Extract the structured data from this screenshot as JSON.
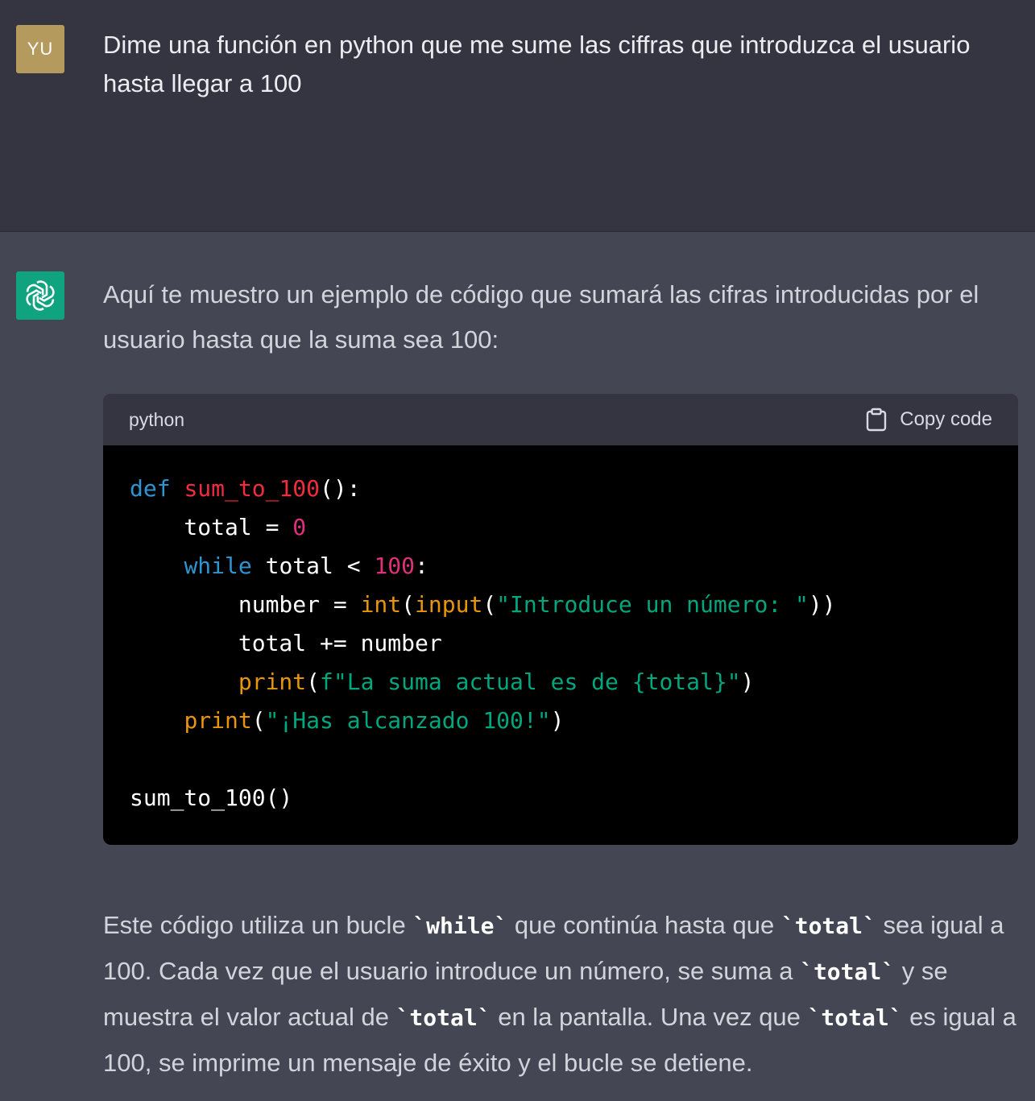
{
  "user": {
    "avatar_initials": "YU",
    "message": "Dime una función en python que me sume las ciffras que introduzca el usuario hasta llegar a 100"
  },
  "assistant": {
    "avatar_icon": "openai-logo-icon",
    "intro": "Aquí te muestro un ejemplo de código que sumará las cifras introducidas por el usuario hasta que la suma sea 100:",
    "code_block": {
      "language": "python",
      "copy_label": "Copy code",
      "copy_icon": "clipboard-icon",
      "lines": {
        "l1_def": "def",
        "l1_name": "sum_to_100",
        "l1_rest": "():",
        "l2_text": "    total = ",
        "l2_num": "0",
        "l3_kw": "while",
        "l3_text": " total < ",
        "l3_num": "100",
        "l3_rest": ":",
        "l4_text": "        number = ",
        "l4_int": "int",
        "l4_paren1": "(",
        "l4_input": "input",
        "l4_paren2": "(",
        "l4_str": "\"Introduce un número: \"",
        "l4_rest": "))",
        "l5_text": "        total += number",
        "l6_indent": "        ",
        "l6_print": "print",
        "l6_paren": "(",
        "l6_str": "f\"La suma actual es de {total}\"",
        "l6_rest": ")",
        "l7_indent": "    ",
        "l7_print": "print",
        "l7_paren": "(",
        "l7_str": "\"¡Has alcanzado 100!\"",
        "l7_rest": ")",
        "l9_call": "sum_to_100()"
      }
    },
    "explanation": {
      "p1": "Este código utiliza un bucle ",
      "c1": "`while`",
      "p2": " que continúa hasta que ",
      "c2": "`total`",
      "p3": " sea igual a 100. Cada vez que el usuario introduce un número, se suma a ",
      "c3": "`total`",
      "p4": " y se muestra el valor actual de ",
      "c4": "`total`",
      "p5": " en la pantalla. Una vez que ",
      "c5": "`total`",
      "p6": " es igual a 100, se imprime un mensaje de éxito y el bucle se detiene."
    }
  }
}
